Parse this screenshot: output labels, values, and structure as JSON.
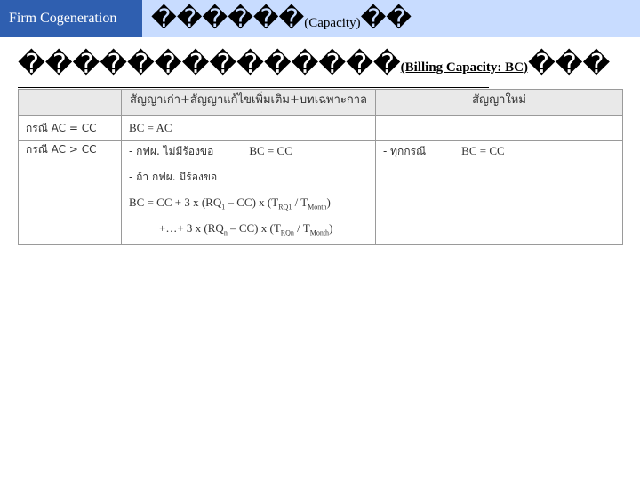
{
  "header": {
    "tag": "Firm Cogeneration",
    "title_glyphs_a": "������",
    "title_paren": "(Capacity)",
    "title_glyphs_b": "��"
  },
  "subtitle": {
    "glyphs_a": "��������������",
    "paren": "(Billing Capacity: BC)",
    "glyphs_b": "���"
  },
  "table": {
    "col_headers": [
      "",
      "สัญญาเก่า+สัญญาแก้ไขเพิ่มเติม+บทเฉพาะกาล",
      "สัญญาใหม่"
    ],
    "row1": {
      "case": "กรณี AC = CC",
      "old": "BC = AC",
      "new": ""
    },
    "row2": {
      "case": "กรณี AC > CC",
      "old_line1_a": "- กฟผ. ไม่มีร้องขอ",
      "old_line1_b": "BC = CC",
      "old_line2": "- ถ้า กฟผ. มีร้องขอ",
      "formula1_a": "BC = CC + 3 x (RQ",
      "formula1_sub1": "1",
      "formula1_b": " – CC) x (T",
      "formula1_sub2": "RQ1",
      "formula1_c": " / T",
      "formula1_sub3": "Month",
      "formula1_d": ")",
      "formula2_a": "+…+ 3 x (RQ",
      "formula2_sub1": "n",
      "formula2_b": " – CC) x (T",
      "formula2_sub2": "RQn",
      "formula2_c": " / T",
      "formula2_sub3": "Month",
      "formula2_d": ")",
      "new_a": "- ทุกกรณี",
      "new_b": "BC = CC"
    }
  }
}
